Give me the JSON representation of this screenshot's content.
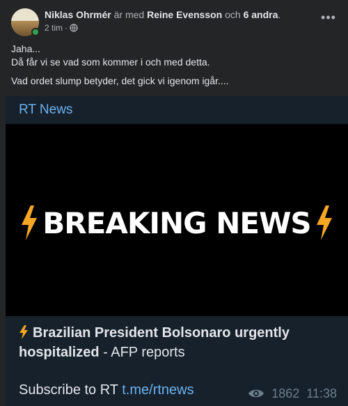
{
  "post": {
    "author": "Niklas Ohrmér",
    "with_text": "är med",
    "tagged": "Reine Evensson",
    "and_text": "och",
    "others": "6 andra",
    "period": ".",
    "time": "2 tim",
    "dot": "·",
    "privacy_icon": "globe-icon",
    "more_label": "•••",
    "lines": [
      "Jaha...",
      "Då får vi se vad som kommer i och med detta.",
      "Vad ordet slump betyder, det gick vi igenom igår...."
    ]
  },
  "card": {
    "channel": "RT News",
    "image_text": "BREAKING NEWS",
    "headline_bold": "Brazilian President Bolsonaro urgently hospitalized",
    "headline_rest": " - AFP reports",
    "subscribe_text": "Subscribe to RT ",
    "subscribe_link": "t.me/rtnews",
    "views": "1862",
    "time": "11:38"
  },
  "colors": {
    "background": "#242526",
    "card": "#17212b",
    "link": "#6ab2f2",
    "online": "#31a24c",
    "bolt": "#f5a623"
  }
}
